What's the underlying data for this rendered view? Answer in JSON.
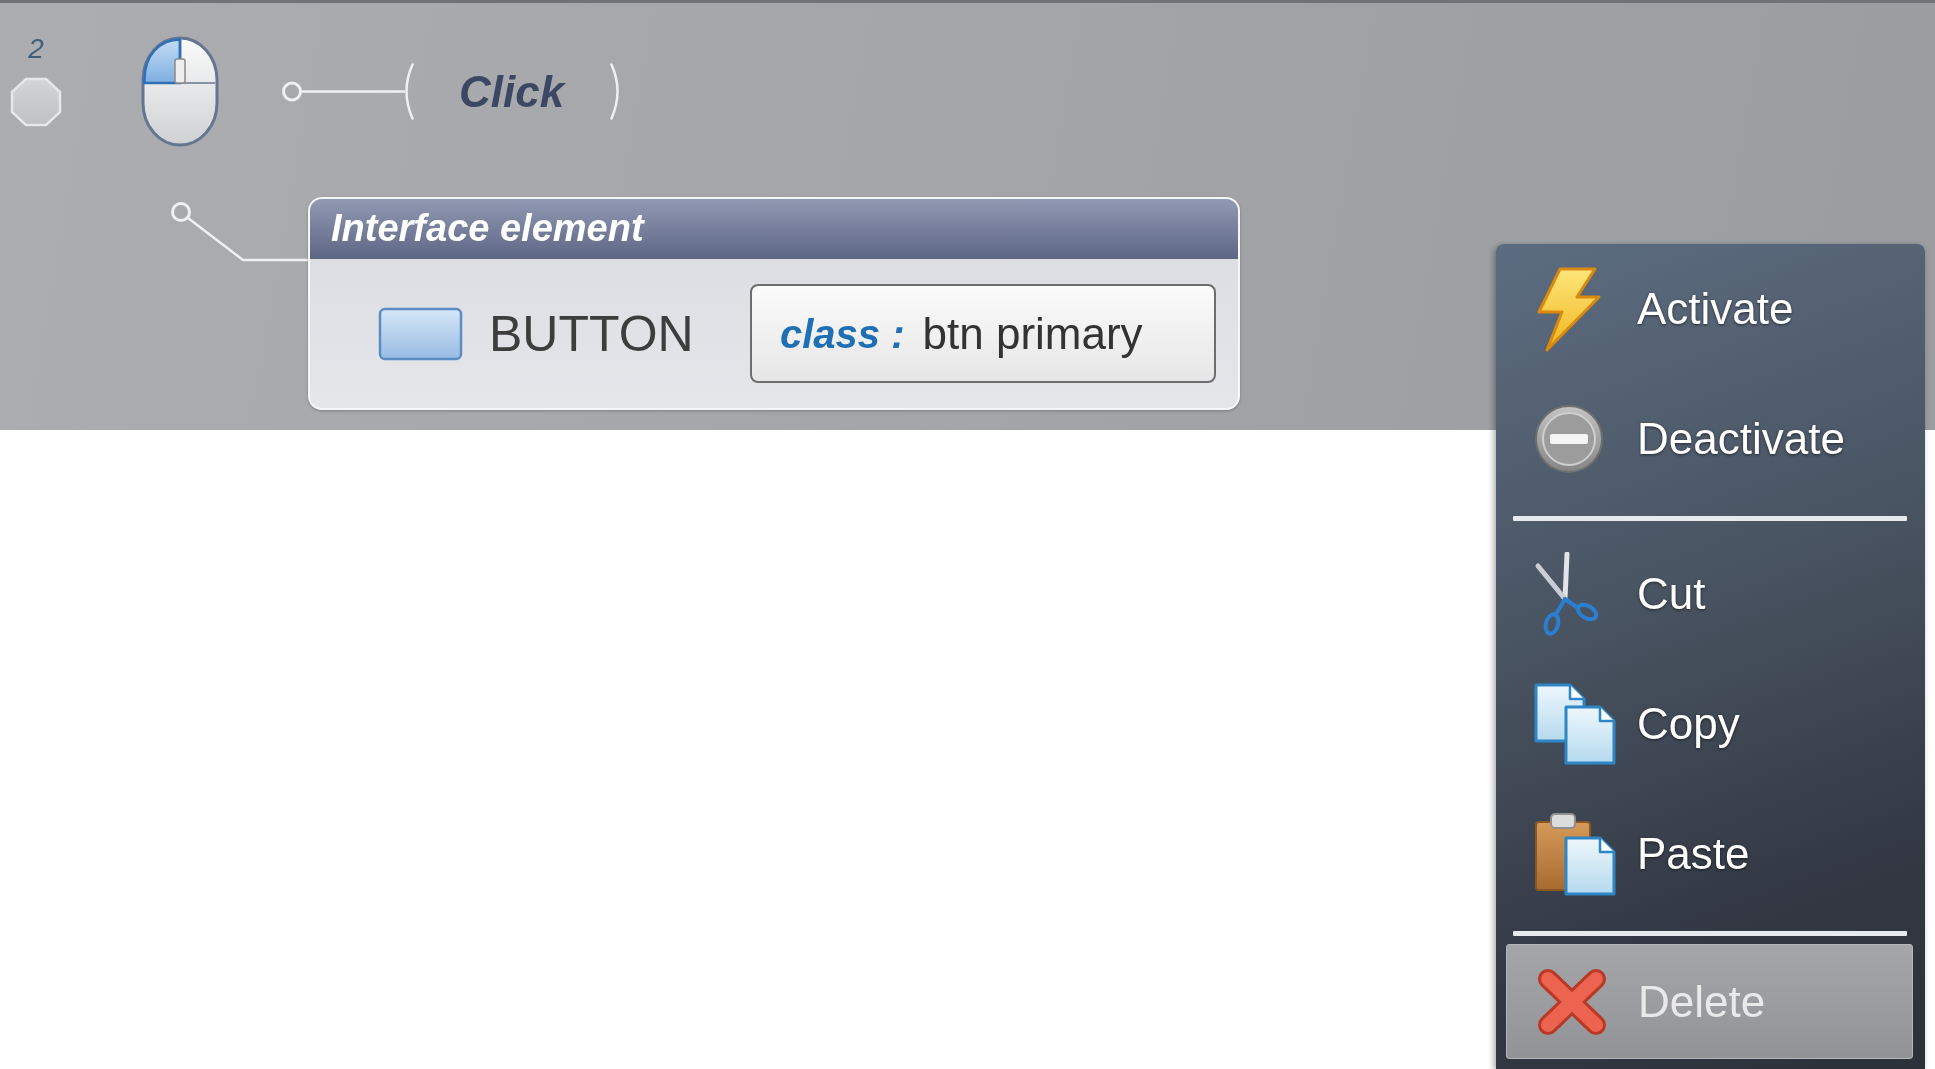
{
  "step": {
    "number": "2"
  },
  "action": {
    "label": "Click"
  },
  "element": {
    "title": "Interface element",
    "type": "BUTTON",
    "attribute": {
      "name": "class :",
      "value": "btn primary"
    }
  },
  "context_menu": {
    "groups": [
      {
        "items": [
          {
            "label": "Activate",
            "selected": false
          },
          {
            "label": "Deactivate",
            "selected": false
          }
        ]
      },
      {
        "items": [
          {
            "label": "Cut",
            "selected": false
          },
          {
            "label": "Copy",
            "selected": false
          },
          {
            "label": "Paste",
            "selected": false
          }
        ]
      },
      {
        "items": [
          {
            "label": "Delete",
            "selected": true
          }
        ]
      }
    ]
  }
}
